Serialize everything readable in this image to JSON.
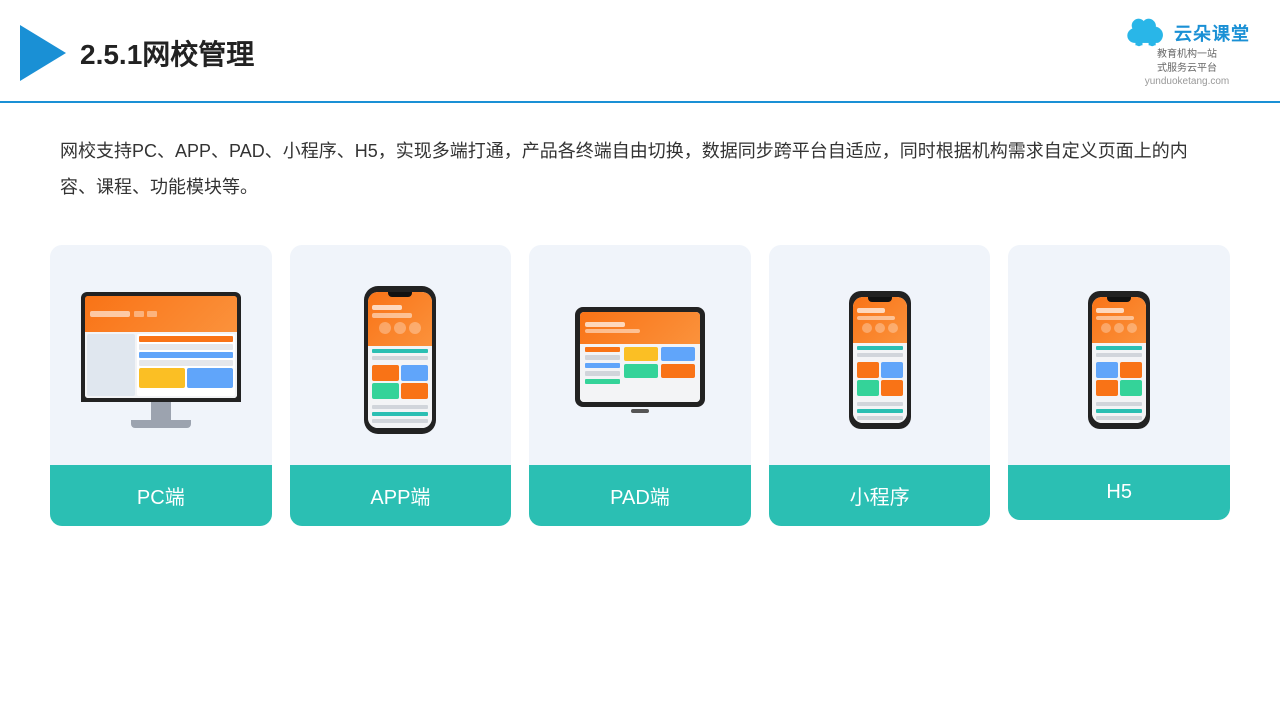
{
  "header": {
    "title": "2.5.1网校管理",
    "brand_name": "云朵课堂",
    "brand_url": "yunduoketang.com",
    "brand_slogan": "教育机构一站\n式服务云平台"
  },
  "description": {
    "text": "网校支持PC、APP、PAD、小程序、H5，实现多端打通，产品各终端自由切换，数据同步跨平台自适应，同时根据机构需求自定义页面上的内容、课程、功能模块等。"
  },
  "cards": [
    {
      "id": "pc",
      "label": "PC端"
    },
    {
      "id": "app",
      "label": "APP端"
    },
    {
      "id": "pad",
      "label": "PAD端"
    },
    {
      "id": "miniapp",
      "label": "小程序"
    },
    {
      "id": "h5",
      "label": "H5"
    }
  ]
}
